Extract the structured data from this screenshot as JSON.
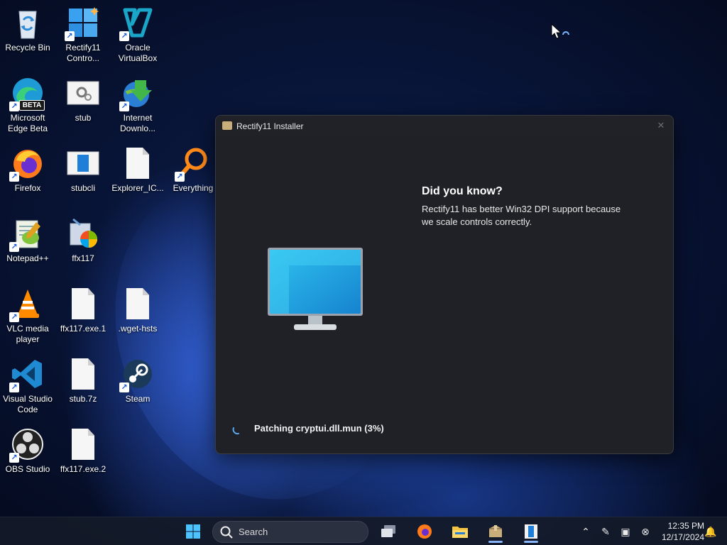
{
  "desktop": {
    "icons": [
      {
        "label": "Recycle Bin",
        "icon": "recycle-bin-icon"
      },
      {
        "label": "Rectify11 Contro...",
        "icon": "rectify11-control-icon"
      },
      {
        "label": "Oracle VirtualBox",
        "icon": "virtualbox-icon"
      },
      {
        "label": "Microsoft Edge Beta",
        "icon": "edge-beta-icon"
      },
      {
        "label": "stub",
        "icon": "settings-file-icon"
      },
      {
        "label": "Internet Downlo...",
        "icon": "internet-download-manager-icon"
      },
      {
        "label": "Firefox",
        "icon": "firefox-icon"
      },
      {
        "label": "stubcli",
        "icon": "window-app-icon"
      },
      {
        "label": "Explorer_IC...",
        "icon": "document-icon"
      },
      {
        "label": "Everything",
        "icon": "everything-search-icon"
      },
      {
        "label": "Notepad++",
        "icon": "notepad-plus-plus-icon"
      },
      {
        "label": "ffx117",
        "icon": "installer-icon"
      },
      {
        "label": "VLC media player",
        "icon": "vlc-icon"
      },
      {
        "label": "ffx117.exe.1",
        "icon": "document-icon"
      },
      {
        "label": ".wget-hsts",
        "icon": "document-icon"
      },
      {
        "label": "Visual Studio Code",
        "icon": "vscode-icon"
      },
      {
        "label": "stub.7z",
        "icon": "document-icon"
      },
      {
        "label": "Steam",
        "icon": "steam-icon"
      },
      {
        "label": "OBS Studio",
        "icon": "obs-icon"
      },
      {
        "label": "ffx117.exe.2",
        "icon": "document-icon"
      }
    ],
    "edge_badge": "BETA"
  },
  "installer": {
    "title": "Rectify11 Installer",
    "close_glyph": "✕",
    "tip_title": "Did you know?",
    "tip_body": "Rectify11 has better Win32 DPI support because we scale controls correctly.",
    "status": "Patching cryptui.dll.mun (3%)"
  },
  "taskbar": {
    "search_placeholder": "Search",
    "time": "12:35 PM",
    "date": "12/17/2024"
  },
  "colors": {
    "accent": "#8ab4f8",
    "window_bg": "#1f2126",
    "monitor_screen": "#27a6e0"
  }
}
